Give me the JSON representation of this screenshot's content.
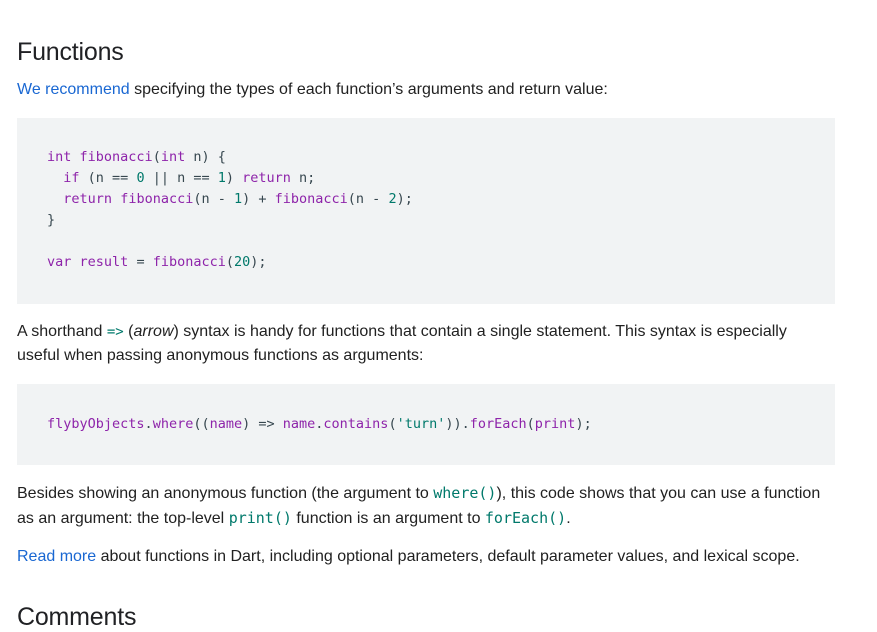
{
  "sections": {
    "functions_title": "Functions",
    "comments_title": "Comments"
  },
  "intro": {
    "link": "We recommend",
    "rest": " specifying the types of each function’s arguments and return value:"
  },
  "code1": {
    "lines": [
      [
        "int",
        " ",
        "fibonacci",
        "(",
        "int",
        " n) {"
      ],
      [
        "if",
        " (n == ",
        "0",
        " || n == ",
        "1",
        ") ",
        "return",
        " n;"
      ],
      [
        "return",
        " ",
        "fibonacci",
        "(n - ",
        "1",
        ") + ",
        "fibonacci",
        "(n - ",
        "2",
        ");"
      ],
      [
        "}"
      ],
      [
        "var",
        " ",
        "result",
        " = ",
        "fibonacci",
        "(",
        "20",
        ");"
      ]
    ]
  },
  "arrow_para": {
    "t1": "A shorthand ",
    "code": "=>",
    "t2": " (",
    "em": "arrow",
    "t3": ") syntax is handy for functions that contain a single statement. This syntax is especially useful when passing anonymous functions as arguments:"
  },
  "code2": {
    "parts": [
      "flybyObjects",
      ".",
      "where",
      "((",
      "name",
      ") => ",
      "name",
      ".",
      "contains",
      "(",
      "'turn'",
      ")).",
      "forEach",
      "(",
      "print",
      ");"
    ]
  },
  "besides_para": {
    "t1": "Besides showing an anonymous function (the argument to ",
    "c1": "where()",
    "t2": "), this code shows that you can use a function as an argument: the top-level ",
    "c2": "print()",
    "t3": " function is an argument to ",
    "c3": "forEach()",
    "t4": "."
  },
  "readmore_para": {
    "link": "Read more",
    "rest": " about functions in Dart, including optional parameters, default parameter values, and lexical scope."
  }
}
